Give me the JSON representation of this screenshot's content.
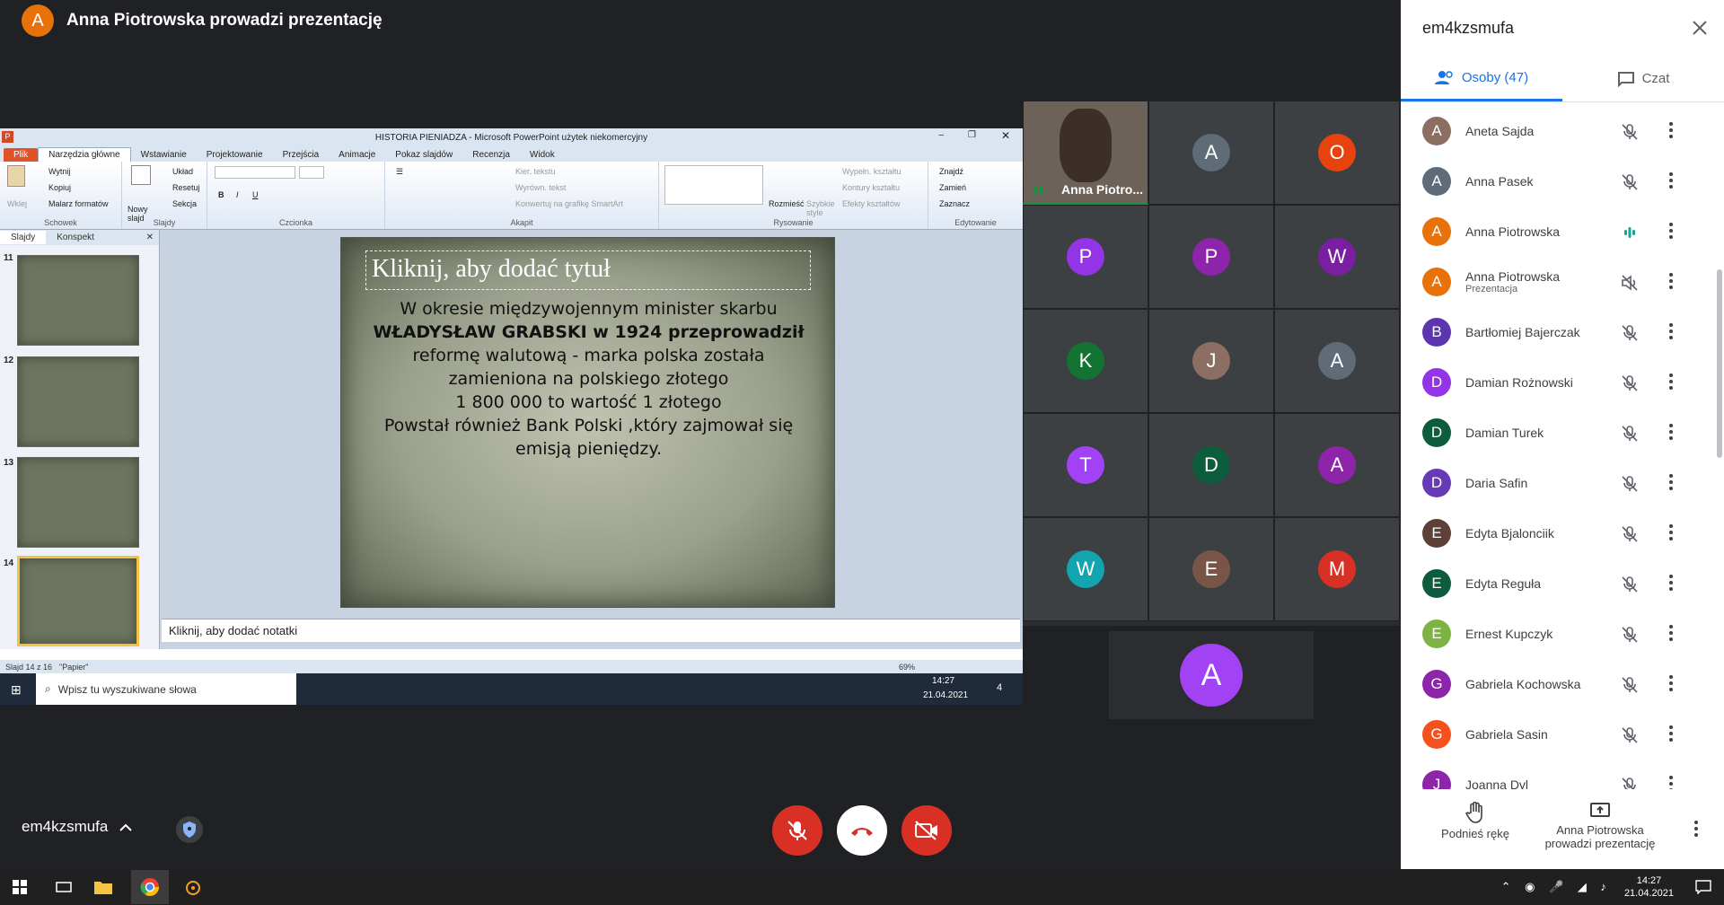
{
  "presenter_bar": {
    "avatar_letter": "A",
    "title": "Anna Piotrowska prowadzi prezentację"
  },
  "ppt": {
    "window_title": "HISTORIA PIENIADZA - Microsoft PowerPoint użytek niekomercyjny",
    "tabs": [
      "Plik",
      "Narzędzia główne",
      "Wstawianie",
      "Projektowanie",
      "Przejścia",
      "Animacje",
      "Pokaz slajdów",
      "Recenzja",
      "Widok"
    ],
    "ribbon": {
      "groups": [
        "Schowek",
        "Slajdy",
        "Czcionka",
        "Akapit",
        "Rysowanie",
        "Edytowanie"
      ],
      "paste": "Wklej",
      "cut": "Wytnij",
      "copy": "Kopiuj",
      "format_painter": "Malarz formatów",
      "new_slide": "Nowy slajd",
      "layout": "Układ",
      "reset": "Resetuj",
      "section": "Sekcja",
      "text_direction": "Kier. tekstu",
      "align_text": "Wyrówn. tekst",
      "smartart": "Konwertuj na grafikę SmartArt",
      "arrange": "Rozmieść",
      "quick_styles": "Szybkie style",
      "fill": "Wypełn. kształtu",
      "outline": "Kontury kształtu",
      "effects": "Efekty kształtów",
      "find": "Znajdź",
      "replace": "Zamień",
      "select": "Zaznacz"
    },
    "pane_tabs": [
      "Slajdy",
      "Konspekt"
    ],
    "thumbnails": [
      {
        "num": "11",
        "text": "W okresie okupacji strefy ..."
      },
      {
        "num": "12",
        "text": "Po 11 listopada ..."
      },
      {
        "num": "13",
        "text": "Po odzyskaniu przez Polskę..."
      },
      {
        "num": "14",
        "text": "W okresie międzywojennym ..."
      }
    ],
    "slide": {
      "title_placeholder": "Kliknij, aby dodać tytuł",
      "body_lines": [
        "W okresie międzywojennym minister skarbu",
        "WŁADYSŁAW GRABSKI w 1924 przeprowadził",
        "reformę walutową - marka polska została",
        "zamieniona na polskiego złotego",
        "1 800 000 to  wartość 1 złotego",
        "Powstał również Bank Polski ,który zajmował się",
        "emisją pieniędzy."
      ]
    },
    "notes_placeholder": "Kliknij, aby dodać notatki",
    "status": {
      "slide": "Slajd 14 z 16",
      "theme": "\"Papier\"",
      "zoom": "69%"
    },
    "inner_taskbar": {
      "search_placeholder": "Wpisz tu wyszukiwane słowa",
      "time": "14:27",
      "date": "21.04.2021",
      "notif_count": "4"
    }
  },
  "tiles": [
    {
      "label": "Anna Piotro...",
      "video": true
    },
    {
      "letter": "A",
      "color": "#5f6b77"
    },
    {
      "letter": "O",
      "color": "#e8430e"
    },
    {
      "letter": "P",
      "color": "#9334e6"
    },
    {
      "letter": "P",
      "color": "#8e24aa"
    },
    {
      "letter": "W",
      "color": "#7b1fa2"
    },
    {
      "letter": "K",
      "color": "#137333"
    },
    {
      "letter": "J",
      "color": "#8d6e63"
    },
    {
      "letter": "A",
      "color": "#5f6b77"
    },
    {
      "letter": "T",
      "color": "#a142f4"
    },
    {
      "letter": "D",
      "color": "#0d5c3e"
    },
    {
      "letter": "A",
      "color": "#8e24aa"
    },
    {
      "letter": "W",
      "color": "#12a4af"
    },
    {
      "letter": "E",
      "color": "#795548"
    },
    {
      "letter": "M",
      "color": "#d93025"
    },
    {
      "letter": "A",
      "color": "#a142f4"
    }
  ],
  "panel": {
    "meeting_code": "em4kzsmufa",
    "tab_people": "Osoby (47)",
    "tab_chat": "Czat",
    "people": [
      {
        "letter": "A",
        "name": "Aneta Sajda",
        "color": "#8d6e63",
        "status": "muted"
      },
      {
        "letter": "A",
        "name": "Anna Pasek",
        "color": "#5f6b77",
        "status": "muted"
      },
      {
        "letter": "A",
        "name": "Anna Piotrowska",
        "color": "#e8710a",
        "status": "speaking"
      },
      {
        "letter": "A",
        "name": "Anna Piotrowska",
        "sub": "Prezentacja",
        "color": "#e8710a",
        "status": "sound-off"
      },
      {
        "letter": "B",
        "name": "Bartłomiej Bajerczak",
        "color": "#5e35b1",
        "status": "muted"
      },
      {
        "letter": "D",
        "name": "Damian Rożnowski",
        "color": "#9334e6",
        "status": "muted"
      },
      {
        "letter": "D",
        "name": "Damian Turek",
        "color": "#0d5c3e",
        "status": "muted"
      },
      {
        "letter": "D",
        "name": "Daria Safin",
        "color": "#673ab7",
        "status": "muted"
      },
      {
        "letter": "E",
        "name": "Edyta Bjalonciik",
        "color": "#5d4037",
        "status": "muted"
      },
      {
        "letter": "E",
        "name": "Edyta Reguła",
        "color": "#0d5c3e",
        "status": "muted"
      },
      {
        "letter": "E",
        "name": "Ernest Kupczyk",
        "color": "#7cb342",
        "status": "muted"
      },
      {
        "letter": "G",
        "name": "Gabriela Kochowska",
        "color": "#8e24aa",
        "status": "muted"
      },
      {
        "letter": "G",
        "name": "Gabriela Sasin",
        "color": "#f4511e",
        "status": "muted"
      },
      {
        "letter": "J",
        "name": "Joanna Dyl",
        "color": "#8e24aa",
        "status": "muted"
      }
    ]
  },
  "bottom": {
    "meeting_code": "em4kzsmufa",
    "raise_hand": "Podnieś rękę",
    "presenting": "Anna Piotrowska prowadzi prezentację"
  },
  "wintaskbar": {
    "time": "14:27",
    "date": "21.04.2021"
  }
}
